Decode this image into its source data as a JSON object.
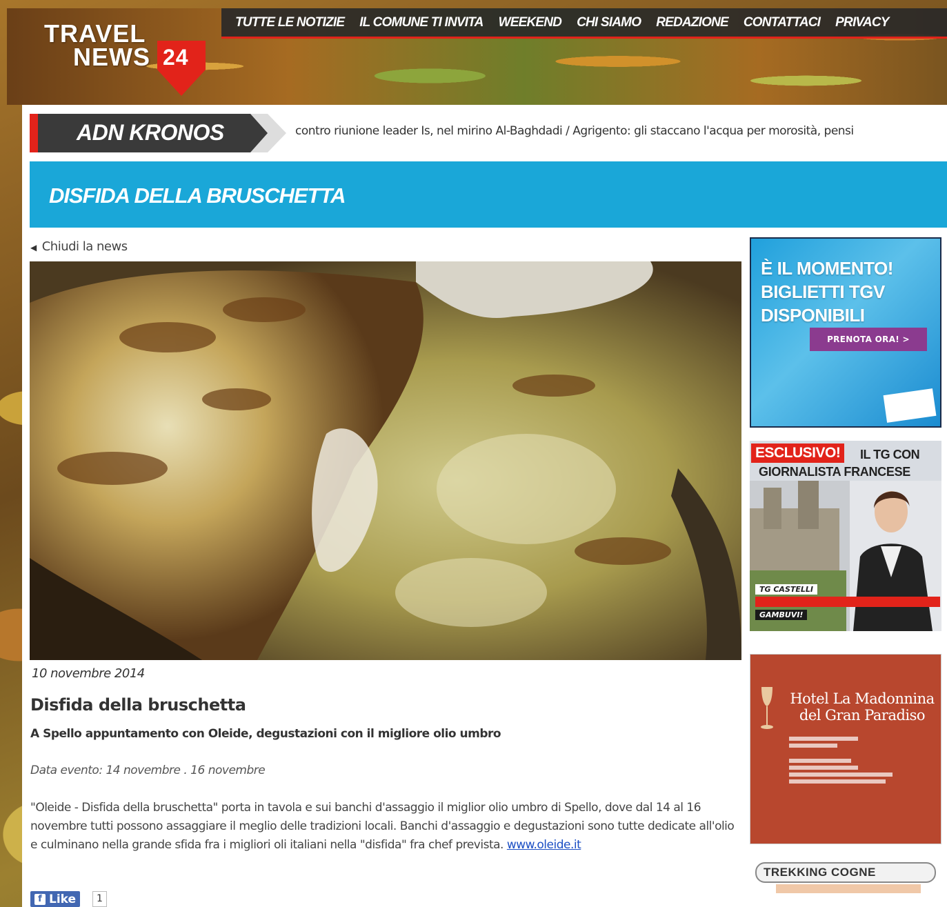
{
  "header": {
    "logo": {
      "line1": "TRAVEL",
      "line2": "NEWS",
      "number": "24"
    },
    "nav": [
      "TUTTE LE NOTIZIE",
      "IL COMUNE TI INVITA",
      "WEEKEND",
      "CHI SIAMO",
      "REDAZIONE",
      "CONTATTACI",
      "PRIVACY"
    ]
  },
  "ticker": {
    "label": "ADN KRONOS",
    "text": "contro riunione leader Is, nel mirino Al-Baghdadi / Agrigento: gli staccano l'acqua per morosità, pensi"
  },
  "page": {
    "title": "DISFIDA DELLA BRUSCHETTA",
    "close_link": "Chiudi la news"
  },
  "article": {
    "date": "10 novembre 2014",
    "title": "Disfida della bruschetta",
    "subtitle": "A Spello appuntamento con Oleide, degustazioni con il migliore olio umbro",
    "event_date": "Data evento: 14 novembre . 16 novembre",
    "body": "\"Oleide - Disfida della bruschetta\" porta in tavola e sui banchi d'assaggio il miglior olio umbro di Spello, dove dal 14 al 16 novembre tutti possono assaggiare il meglio delle tradizioni locali. Banchi d'assaggio e degustazioni sono tutte dedicate all'olio e culminano nella grande sfida fra i migliori oli italiani nella \"disfida\" fra chef prevista.",
    "link": "www.oleide.it",
    "like_label": "Like",
    "like_count": "1"
  },
  "ads": {
    "tgv": {
      "line1": "È IL MOMENTO!",
      "line2": "BIGLIETTI TGV",
      "line3": "DISPONIBILI",
      "cta": "PRENOTA ORA! >"
    },
    "tg": {
      "badge": "ESCLUSIVO!",
      "line1": "IL TG CON",
      "line2": "GIORNALISTA FRANCESE",
      "caption1": "TG CASTELLI",
      "caption3": "GAMBUVI!"
    },
    "hotel": {
      "name": "Hotel La Madonnina del Gran Paradiso"
    },
    "trekking": {
      "title": "TREKKING COGNE"
    }
  },
  "colors": {
    "accent_red": "#e2231a",
    "title_blue": "#1aa7d8",
    "nav_bg": "#282828",
    "link_blue": "#1c4fc4"
  }
}
